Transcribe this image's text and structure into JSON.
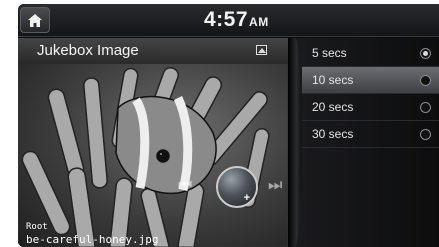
{
  "statusbar": {
    "time": "4:57",
    "ampm": "AM",
    "home_icon": "home-icon"
  },
  "viewer": {
    "title": "Jukebox Image",
    "folder": "Root",
    "filename": "be-careful-honey.jpg",
    "prev_glyph": "⏮",
    "next_glyph": "⏭"
  },
  "slideshow_options": [
    {
      "label": "5 secs",
      "checked": true,
      "selected": false
    },
    {
      "label": "10 secs",
      "checked": false,
      "selected": true
    },
    {
      "label": "20 secs",
      "checked": false,
      "selected": false
    },
    {
      "label": "30 secs",
      "checked": false,
      "selected": false
    }
  ]
}
